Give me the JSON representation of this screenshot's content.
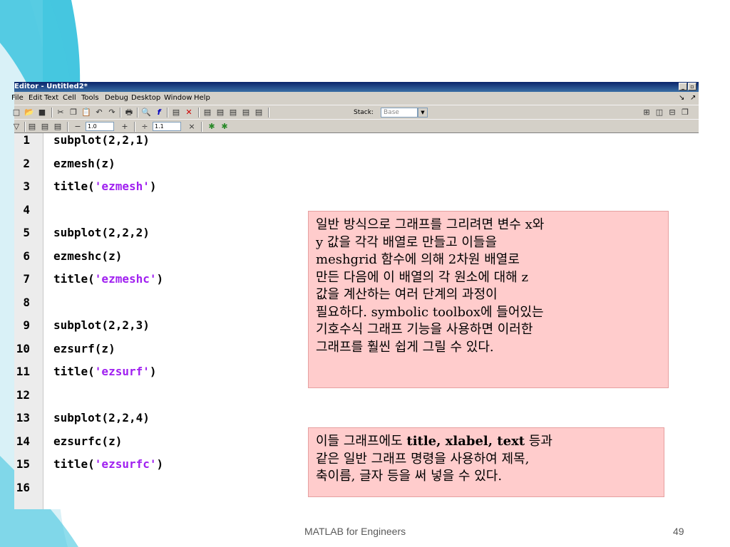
{
  "editor": {
    "title": "Editor - Untitled2*",
    "menu": [
      "File",
      "Edit",
      "Text",
      "Cell",
      "Tools",
      "Debug",
      "Desktop",
      "Window",
      "Help"
    ],
    "stack_label": "Stack:",
    "stack_value": "Base",
    "cell_minus_value": "1.0",
    "cell_divide_value": "1.1",
    "minus_symbol": "−",
    "plus_symbol": "+",
    "divide_symbol": "÷",
    "times_symbol": "×"
  },
  "code_lines": [
    {
      "num": "1",
      "pre": "subplot(2,2,1)",
      "str": "",
      "post": ""
    },
    {
      "num": "2",
      "pre": "ezmesh(z)",
      "str": "",
      "post": ""
    },
    {
      "num": "3",
      "pre": "title(",
      "str": "'ezmesh'",
      "post": ")"
    },
    {
      "num": "4",
      "pre": "",
      "str": "",
      "post": ""
    },
    {
      "num": "5",
      "pre": "subplot(2,2,2)",
      "str": "",
      "post": ""
    },
    {
      "num": "6",
      "pre": "ezmeshc(z)",
      "str": "",
      "post": ""
    },
    {
      "num": "7",
      "pre": "title(",
      "str": "'ezmeshc'",
      "post": ")"
    },
    {
      "num": "8",
      "pre": "",
      "str": "",
      "post": ""
    },
    {
      "num": "9",
      "pre": "subplot(2,2,3)",
      "str": "",
      "post": ""
    },
    {
      "num": "10",
      "pre": "ezsurf(z)",
      "str": "",
      "post": ""
    },
    {
      "num": "11",
      "pre": "title(",
      "str": "'ezsurf'",
      "post": ")"
    },
    {
      "num": "12",
      "pre": "",
      "str": "",
      "post": ""
    },
    {
      "num": "13",
      "pre": "subplot(2,2,4)",
      "str": "",
      "post": ""
    },
    {
      "num": "14",
      "pre": "ezsurfc(z)",
      "str": "",
      "post": ""
    },
    {
      "num": "15",
      "pre": "title(",
      "str": "'ezsurfc'",
      "post": ")"
    },
    {
      "num": "16",
      "pre": "",
      "str": "",
      "post": ""
    }
  ],
  "note1": [
    "일반 방식으로 그래프를 그리려면 변수 x와",
    "y 값을 각각 배열로 만들고 이들을",
    "meshgrid  함수에 의해 2차원 배열로",
    "만든 다음에 이 배열의 각 원소에 대해 z",
    "값을 계산하는 여러 단계의 과정이",
    "필요하다. symbolic toolbox에 들어있는",
    "기호수식 그래프 기능을 사용하면 이러한",
    "그래프를 훨씬 쉽게 그릴 수 있다."
  ],
  "note2": {
    "l1_pre": "이들 그래프에도 ",
    "l1_bold": "title, xlabel, text",
    "l1_post": " 등과",
    "l2": "같은 일반 그래프 명령을 사용하여 제목,",
    "l3": "축이름, 글자 등을 써 넣을 수 있다."
  },
  "footer": {
    "title": "MATLAB for Engineers",
    "page": "49"
  },
  "colors": {
    "deco_light": "#d9f1f7",
    "deco_dark": "#45c6e0",
    "string": "#a020f0",
    "note_bg": "#ffcccc"
  }
}
